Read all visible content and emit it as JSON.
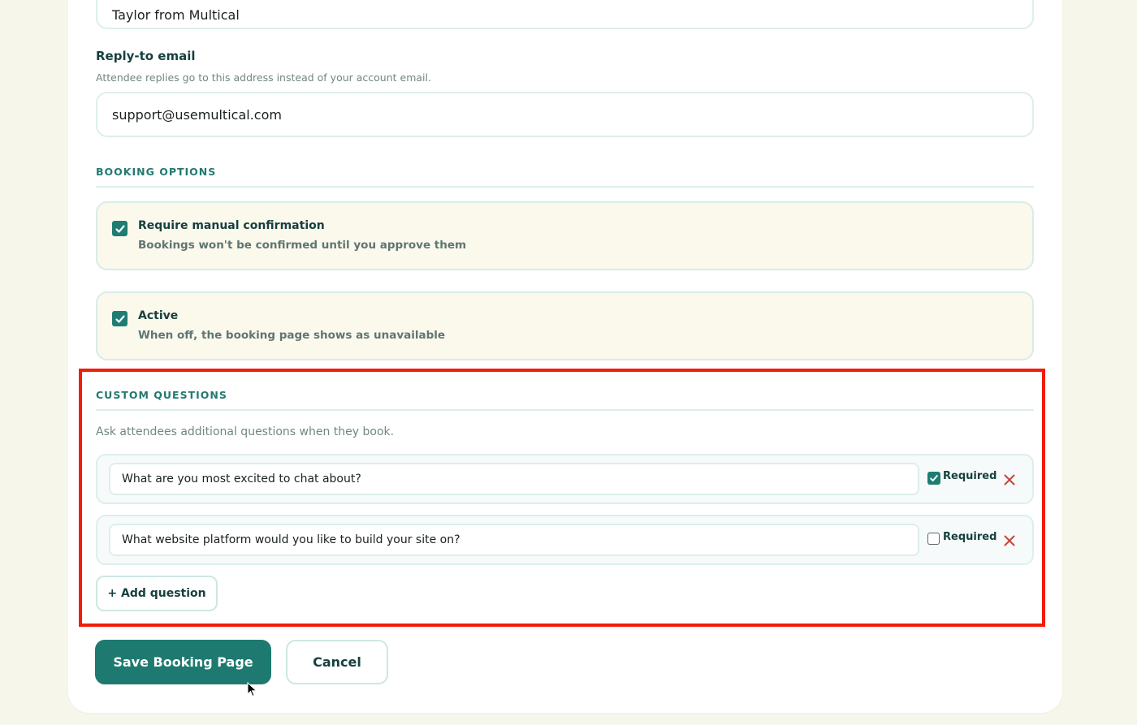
{
  "sender_name": {
    "value": "Taylor from Multical"
  },
  "reply_to": {
    "label": "Reply-to email",
    "hint": "Attendee replies go to this address instead of your account email.",
    "value": "support@usemultical.com"
  },
  "booking_options": {
    "section_title": "BOOKING OPTIONS",
    "items": [
      {
        "title": "Require manual confirmation",
        "description": "Bookings won't be confirmed until you approve them",
        "checked": true
      },
      {
        "title": "Active",
        "description": "When off, the booking page shows as unavailable",
        "checked": true
      }
    ]
  },
  "custom_questions": {
    "section_title": "CUSTOM QUESTIONS",
    "description": "Ask attendees additional questions when they book.",
    "questions": [
      {
        "text": "What are you most excited to chat about?",
        "required_label": "Required",
        "required": true
      },
      {
        "text": "What website platform would you like to build your site on?",
        "required_label": "Required",
        "required": false
      }
    ],
    "add_label": "+ Add question"
  },
  "actions": {
    "save_label": "Save Booking Page",
    "cancel_label": "Cancel"
  },
  "colors": {
    "accent": "#1e7a70",
    "highlight": "#f01d0a",
    "delete": "#c9423d",
    "option_bg": "#fbf8ec"
  }
}
